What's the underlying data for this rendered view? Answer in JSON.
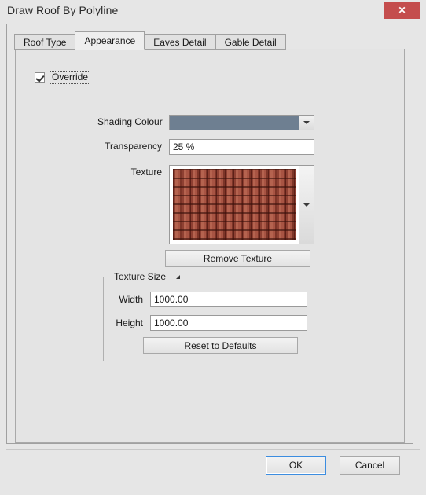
{
  "window": {
    "title": "Draw Roof By Polyline",
    "close_label": "✕"
  },
  "tabs": [
    {
      "label": "Roof Type",
      "active": false
    },
    {
      "label": "Appearance",
      "active": true
    },
    {
      "label": "Eaves Detail",
      "active": false
    },
    {
      "label": "Gable Detail",
      "active": false
    }
  ],
  "appearance": {
    "override": {
      "label": "Override",
      "checked": true
    },
    "shading_colour": {
      "label": "Shading Colour",
      "value": "#6e7f91"
    },
    "transparency": {
      "label": "Transparency",
      "value": "25 %",
      "placeholder": ""
    },
    "texture": {
      "label": "Texture",
      "swatch_name": "terracotta-roof-tiles",
      "base_colour": "#9f4a3a",
      "shadow_colour": "#5d2018",
      "highlight_colour": "#b5634f"
    },
    "remove_texture_label": "Remove Texture",
    "texture_size": {
      "legend": "Texture Size",
      "width_label": "Width",
      "width_value": "1000.00",
      "height_label": "Height",
      "height_value": "1000.00",
      "reset_label": "Reset to Defaults"
    }
  },
  "footer": {
    "ok_label": "OK",
    "cancel_label": "Cancel"
  }
}
